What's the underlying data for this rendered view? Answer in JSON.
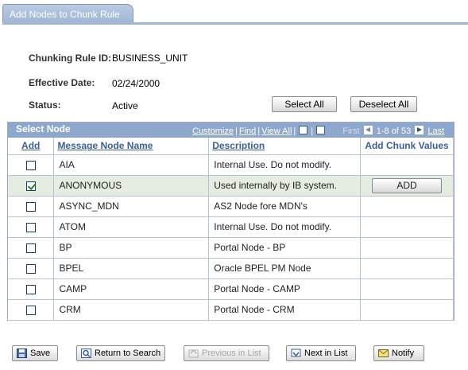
{
  "tab": {
    "label": "Add Nodes to Chunk Rule"
  },
  "fields": {
    "rule_id_label": "Chunking Rule ID:",
    "rule_id_value": "BUSINESS_UNIT",
    "eff_date_label": "Effective Date:",
    "eff_date_value": "02/24/2000",
    "status_label": "Status:",
    "status_value": "Active"
  },
  "actions": {
    "select_all": "Select All",
    "deselect_all": "Deselect All"
  },
  "grid": {
    "title": "Select Node",
    "customize": "Customize",
    "find": "Find",
    "view_all": "View All",
    "first": "First",
    "range": "1-8 of 53",
    "last": "Last",
    "columns": {
      "add": "Add",
      "node": "Message Node Name",
      "description": "Description",
      "chunk": "Add Chunk Values"
    },
    "add_button_label": "ADD",
    "rows": [
      {
        "node": "AIA",
        "description": "Internal Use.  Do not modify.",
        "checked": false
      },
      {
        "node": "ANONYMOUS",
        "description": "Used internally by IB system.",
        "checked": true
      },
      {
        "node": "ASYNC_MDN",
        "description": "AS2 Node fore MDN's",
        "checked": false
      },
      {
        "node": "ATOM",
        "description": "Internal Use.  Do not modify.",
        "checked": false
      },
      {
        "node": "BP",
        "description": "Portal Node - BP",
        "checked": false
      },
      {
        "node": "BPEL",
        "description": "Oracle BPEL PM Node",
        "checked": false
      },
      {
        "node": "CAMP",
        "description": "Portal Node - CAMP",
        "checked": false
      },
      {
        "node": "CRM",
        "description": "Portal Node - CRM",
        "checked": false
      }
    ]
  },
  "toolbar": {
    "save": "Save",
    "return_to_search": "Return to Search",
    "previous_in_list": "Previous in List",
    "next_in_list": "Next in List",
    "notify": "Notify"
  },
  "colors": {
    "header_blue": "#8ea7cc",
    "selected_row": "#e5ece0",
    "check_green": "#1a8a1a"
  }
}
